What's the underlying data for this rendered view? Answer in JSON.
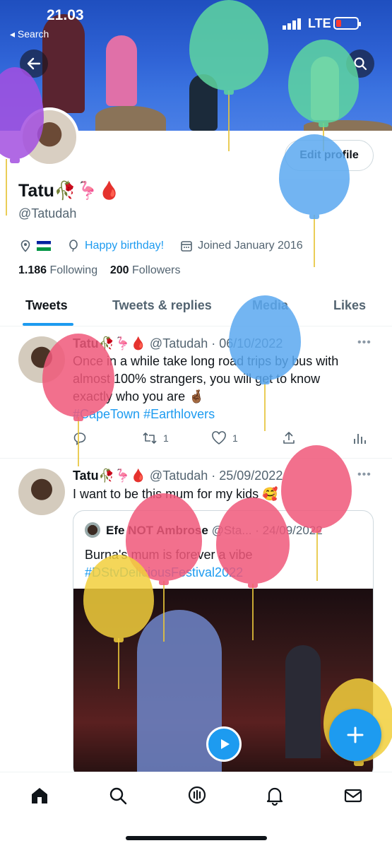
{
  "status_bar": {
    "time": "21.03",
    "back_label": "◂ Search",
    "network": "LTE"
  },
  "profile": {
    "name": "Tatu🥀🦩🩸",
    "handle": "@Tatudah",
    "edit_label": "Edit profile",
    "birthday_text": "Happy birthday!",
    "joined_text": "Joined January 2016",
    "following_count": "1.186",
    "following_label": "Following",
    "followers_count": "200",
    "followers_label": "Followers"
  },
  "tabs": [
    {
      "label": "Tweets"
    },
    {
      "label": "Tweets & replies"
    },
    {
      "label": "Media"
    },
    {
      "label": "Likes"
    }
  ],
  "tweets": [
    {
      "name": "Tatu🥀🦩🩸",
      "meta": "@Tatudah · 06/10/2022",
      "text_line1": "Once in a while take long road trips by bus with",
      "text_line2": "almost 100% strangers, you will get to know",
      "text_line3": "exactly who you are 🤞🏾",
      "hashtags": "#CapeTown #Earthlovers",
      "retweets": "1",
      "likes": "1"
    },
    {
      "name": "Tatu🥀🦩🩸",
      "meta": "@Tatudah · 25/09/2022",
      "text": "I want to be this mum for my kids 🥰",
      "quote": {
        "name": "Efe NOT Ambrose",
        "meta": "@Sta... · 24/09/2022",
        "text_line1": "Burna's mum is forever a vibe",
        "hashtag": "#DStvDeliciousFestival2022"
      }
    }
  ],
  "colors": {
    "accent": "#1d9bf0",
    "balloon_green": "#5ed6a0",
    "balloon_purple": "#a34fe0",
    "balloon_blue": "#5aa8f0",
    "balloon_pink": "#f0587a",
    "balloon_yellow": "#f2cf3c"
  },
  "bottom_nav": [
    "home-icon",
    "search-icon",
    "spaces-icon",
    "notifications-icon",
    "messages-icon"
  ]
}
